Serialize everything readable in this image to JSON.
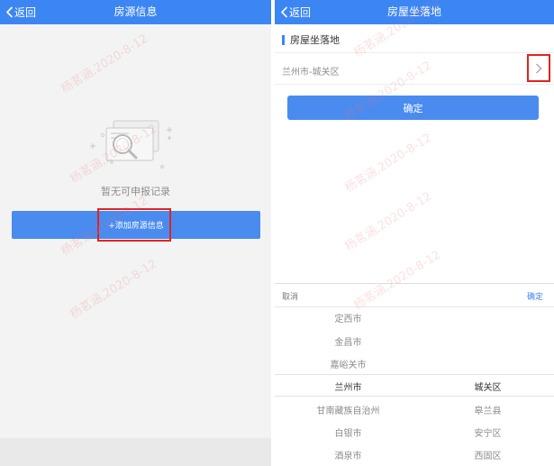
{
  "left_screen": {
    "back_label": "返回",
    "title": "房源信息",
    "empty_text": "暂无可申报记录",
    "add_button_label": "+添加房源信息"
  },
  "right_screen": {
    "back_label": "返回",
    "title": "房屋坐落地",
    "section_title": "房屋坐落地",
    "location_value": "兰州市-城关区",
    "confirm_label": "确定",
    "picker": {
      "cancel_label": "取消",
      "ok_label": "确定",
      "column_1": [
        "定西市",
        "金昌市",
        "嘉峪关市",
        "兰州市",
        "甘南藏族自治州",
        "白银市",
        "酒泉市"
      ],
      "column_1_selected": "兰州市",
      "column_2": [
        "城关区",
        "皋兰县",
        "安宁区",
        "西固区"
      ],
      "column_2_selected": "城关区"
    }
  },
  "watermark_text": "杨茗涵,2020-8-12",
  "colors": {
    "nav_blue": "#3c86f4",
    "button_blue": "#4a8bf0",
    "highlight_red": "#e5231b"
  }
}
